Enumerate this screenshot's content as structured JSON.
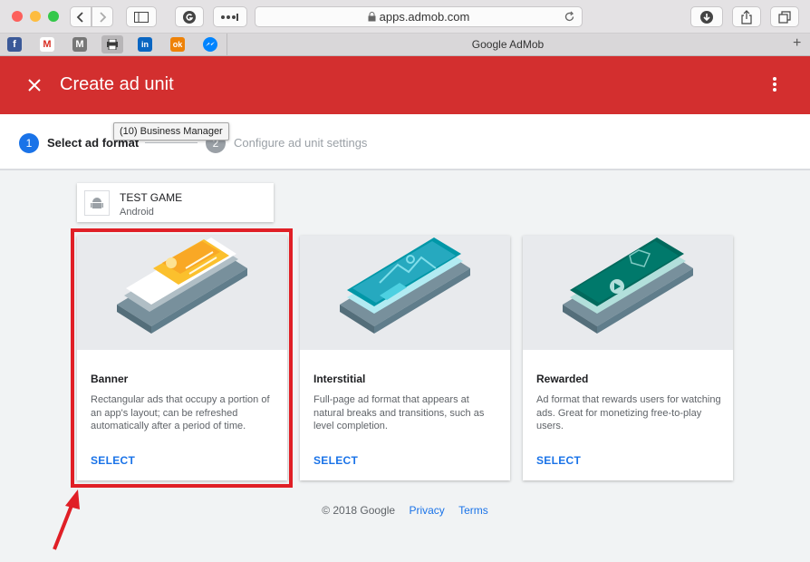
{
  "browser": {
    "url": "apps.admob.com",
    "tab_title": "Google AdMob",
    "bookmarks": [
      {
        "name": "facebook",
        "glyph": "f",
        "color": "#3b5998"
      },
      {
        "name": "gmail",
        "glyph": "M",
        "color": "#ffffff"
      },
      {
        "name": "medium",
        "glyph": "M",
        "color": "#777777"
      },
      {
        "name": "print",
        "glyph": "",
        "color": "#555555"
      },
      {
        "name": "linkedin",
        "glyph": "in",
        "color": "#0a66c2"
      },
      {
        "name": "odnoklassniki",
        "glyph": "ok",
        "color": "#ee8208"
      },
      {
        "name": "messenger",
        "glyph": "",
        "color": "#0084ff"
      }
    ]
  },
  "header": {
    "title": "Create ad unit"
  },
  "stepper": {
    "steps": [
      {
        "number": "1",
        "label": "Select ad format",
        "active": true
      },
      {
        "number": "2",
        "label": "Configure ad unit settings",
        "active": false
      }
    ],
    "tooltip": "(10) Business Manager"
  },
  "app": {
    "name": "TEST GAME",
    "platform": "Android"
  },
  "formats": [
    {
      "name": "Banner",
      "description": "Rectangular ads that occupy a portion of an app's layout; can be refreshed automatically after a period of time.",
      "action": "SELECT"
    },
    {
      "name": "Interstitial",
      "description": "Full-page ad format that appears at natural breaks and transitions, such as level completion.",
      "action": "SELECT"
    },
    {
      "name": "Rewarded",
      "description": "Ad format that rewards users for watching ads. Great for monetizing free-to-play users.",
      "action": "SELECT"
    }
  ],
  "footer": {
    "copyright": "© 2018 Google",
    "privacy": "Privacy",
    "terms": "Terms"
  },
  "colors": {
    "header": "#d32f2f",
    "accent": "#1a73e8",
    "highlight": "#e01f26"
  }
}
